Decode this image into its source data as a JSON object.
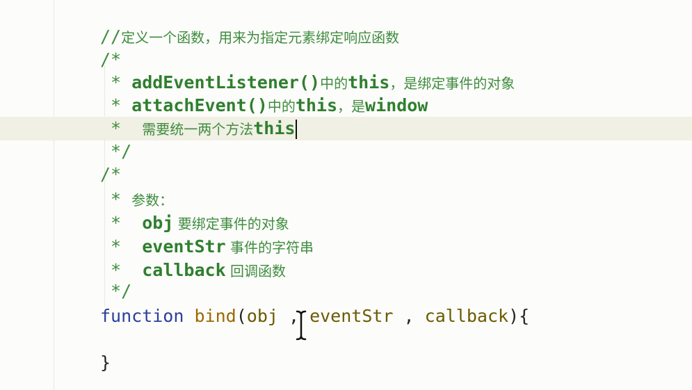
{
  "code": {
    "l1": {
      "slashes": "//",
      "zh": "定义一个函数，用来为指定元素绑定响应函数"
    },
    "l2": "/*",
    "l3": {
      "star": " * ",
      "code": "addEventListener()",
      "zh": "中的",
      "this": "this",
      "zh2": "，是绑定事件的对象"
    },
    "l4": {
      "star": " * ",
      "code": "attachEvent()",
      "zh": "中的",
      "this": "this",
      "zh2": "，是",
      "window": "window"
    },
    "l5": {
      "star": " *  ",
      "zh": "需要统一两个方法",
      "this": "this"
    },
    "l6": " */",
    "l7": "/*",
    "l8": {
      "star": " * ",
      "zh": "参数："
    },
    "l9": {
      "star": " *  ",
      "name": "obj",
      "zh": " 要绑定事件的对象"
    },
    "l10": {
      "star": " *  ",
      "name": "eventStr",
      "zh": " 事件的字符串"
    },
    "l11": {
      "star": " *  ",
      "name": "callback",
      "zh": " 回调函数"
    },
    "l12": " */",
    "l13": {
      "keyword": "function",
      "name": "bind",
      "open": "(",
      "p1": "obj",
      "comma1": " , ",
      "p2": "eventStr",
      "comma2": " , ",
      "p3": "callback",
      "close": "){"
    },
    "l15": "}"
  },
  "colors": {
    "comment": "#3f8c3f",
    "keyword": "#2a3f9f",
    "function_name": "#9a6a00",
    "current_line": "#f0f0e4",
    "background": "#fcfcfa"
  },
  "cursor": {
    "icon": "text-ibeam-cursor-icon"
  }
}
